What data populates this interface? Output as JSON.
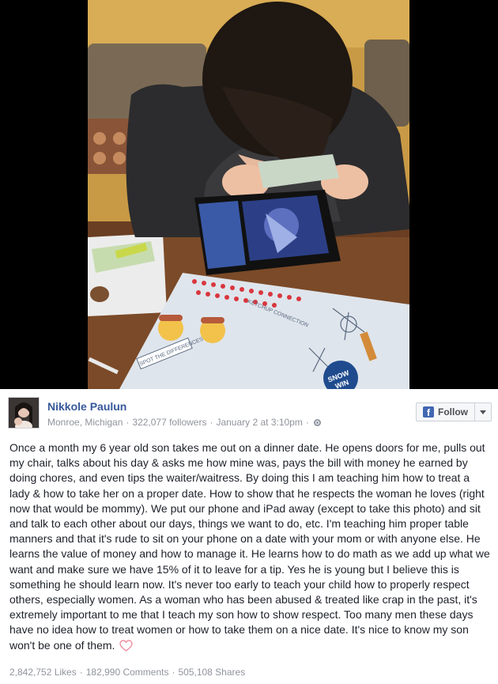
{
  "post": {
    "photo": {
      "description_icon": "photo-of-boy-with-wallet",
      "menu_sheet": {
        "activity_label": "KETCHUP CONNECTION",
        "spot_label": "SPOT THE DIFFERENCES",
        "badge": "SNOW",
        "badge_line2": "WIN"
      }
    },
    "author": {
      "name": "Nikkole Paulun",
      "location": "Monroe, Michigan",
      "followers": "322,077 followers",
      "date": "January 2 at 3:10pm"
    },
    "follow_label": "Follow",
    "text": "Once a month my 6 year old son takes me out on a dinner date. He opens doors for me, pulls out my chair, talks about his day & asks me how mine was, pays the bill with money he earned by doing chores, and even tips the waiter/waitress. By doing this I am teaching him how to treat a lady & how to take her on a proper date. How to show that he respects the woman he loves (right now that would be mommy). We put our phone and iPad away (except to take this photo) and sit and talk to each other about our days, things we want to do, etc. I'm teaching him proper table manners and that it's rude to sit on your phone on a date with your mom or with anyone else. He learns the value of money and how to manage it. He learns how to do math as we add up what we want and make sure we have 15% of it to leave for a tip. Yes he is young but I believe this is something he should learn now. It's never too early to teach your child how to properly respect others, especially women. As a woman who has been abused & treated like crap in the past, it's extremely important to me that I teach my son how to show respect. Too many men these days have no idea how to treat women or how to take them on a nice date. It's nice to know my son won't be one of them.",
    "stats": {
      "likes": "2,842,752 Likes",
      "comments": "182,990 Comments",
      "shares": "505,108 Shares"
    }
  },
  "colors": {
    "link": "#365899",
    "meta": "#90949c",
    "heart": "#f4a7b4",
    "facebook_blue": "#4267b2"
  }
}
